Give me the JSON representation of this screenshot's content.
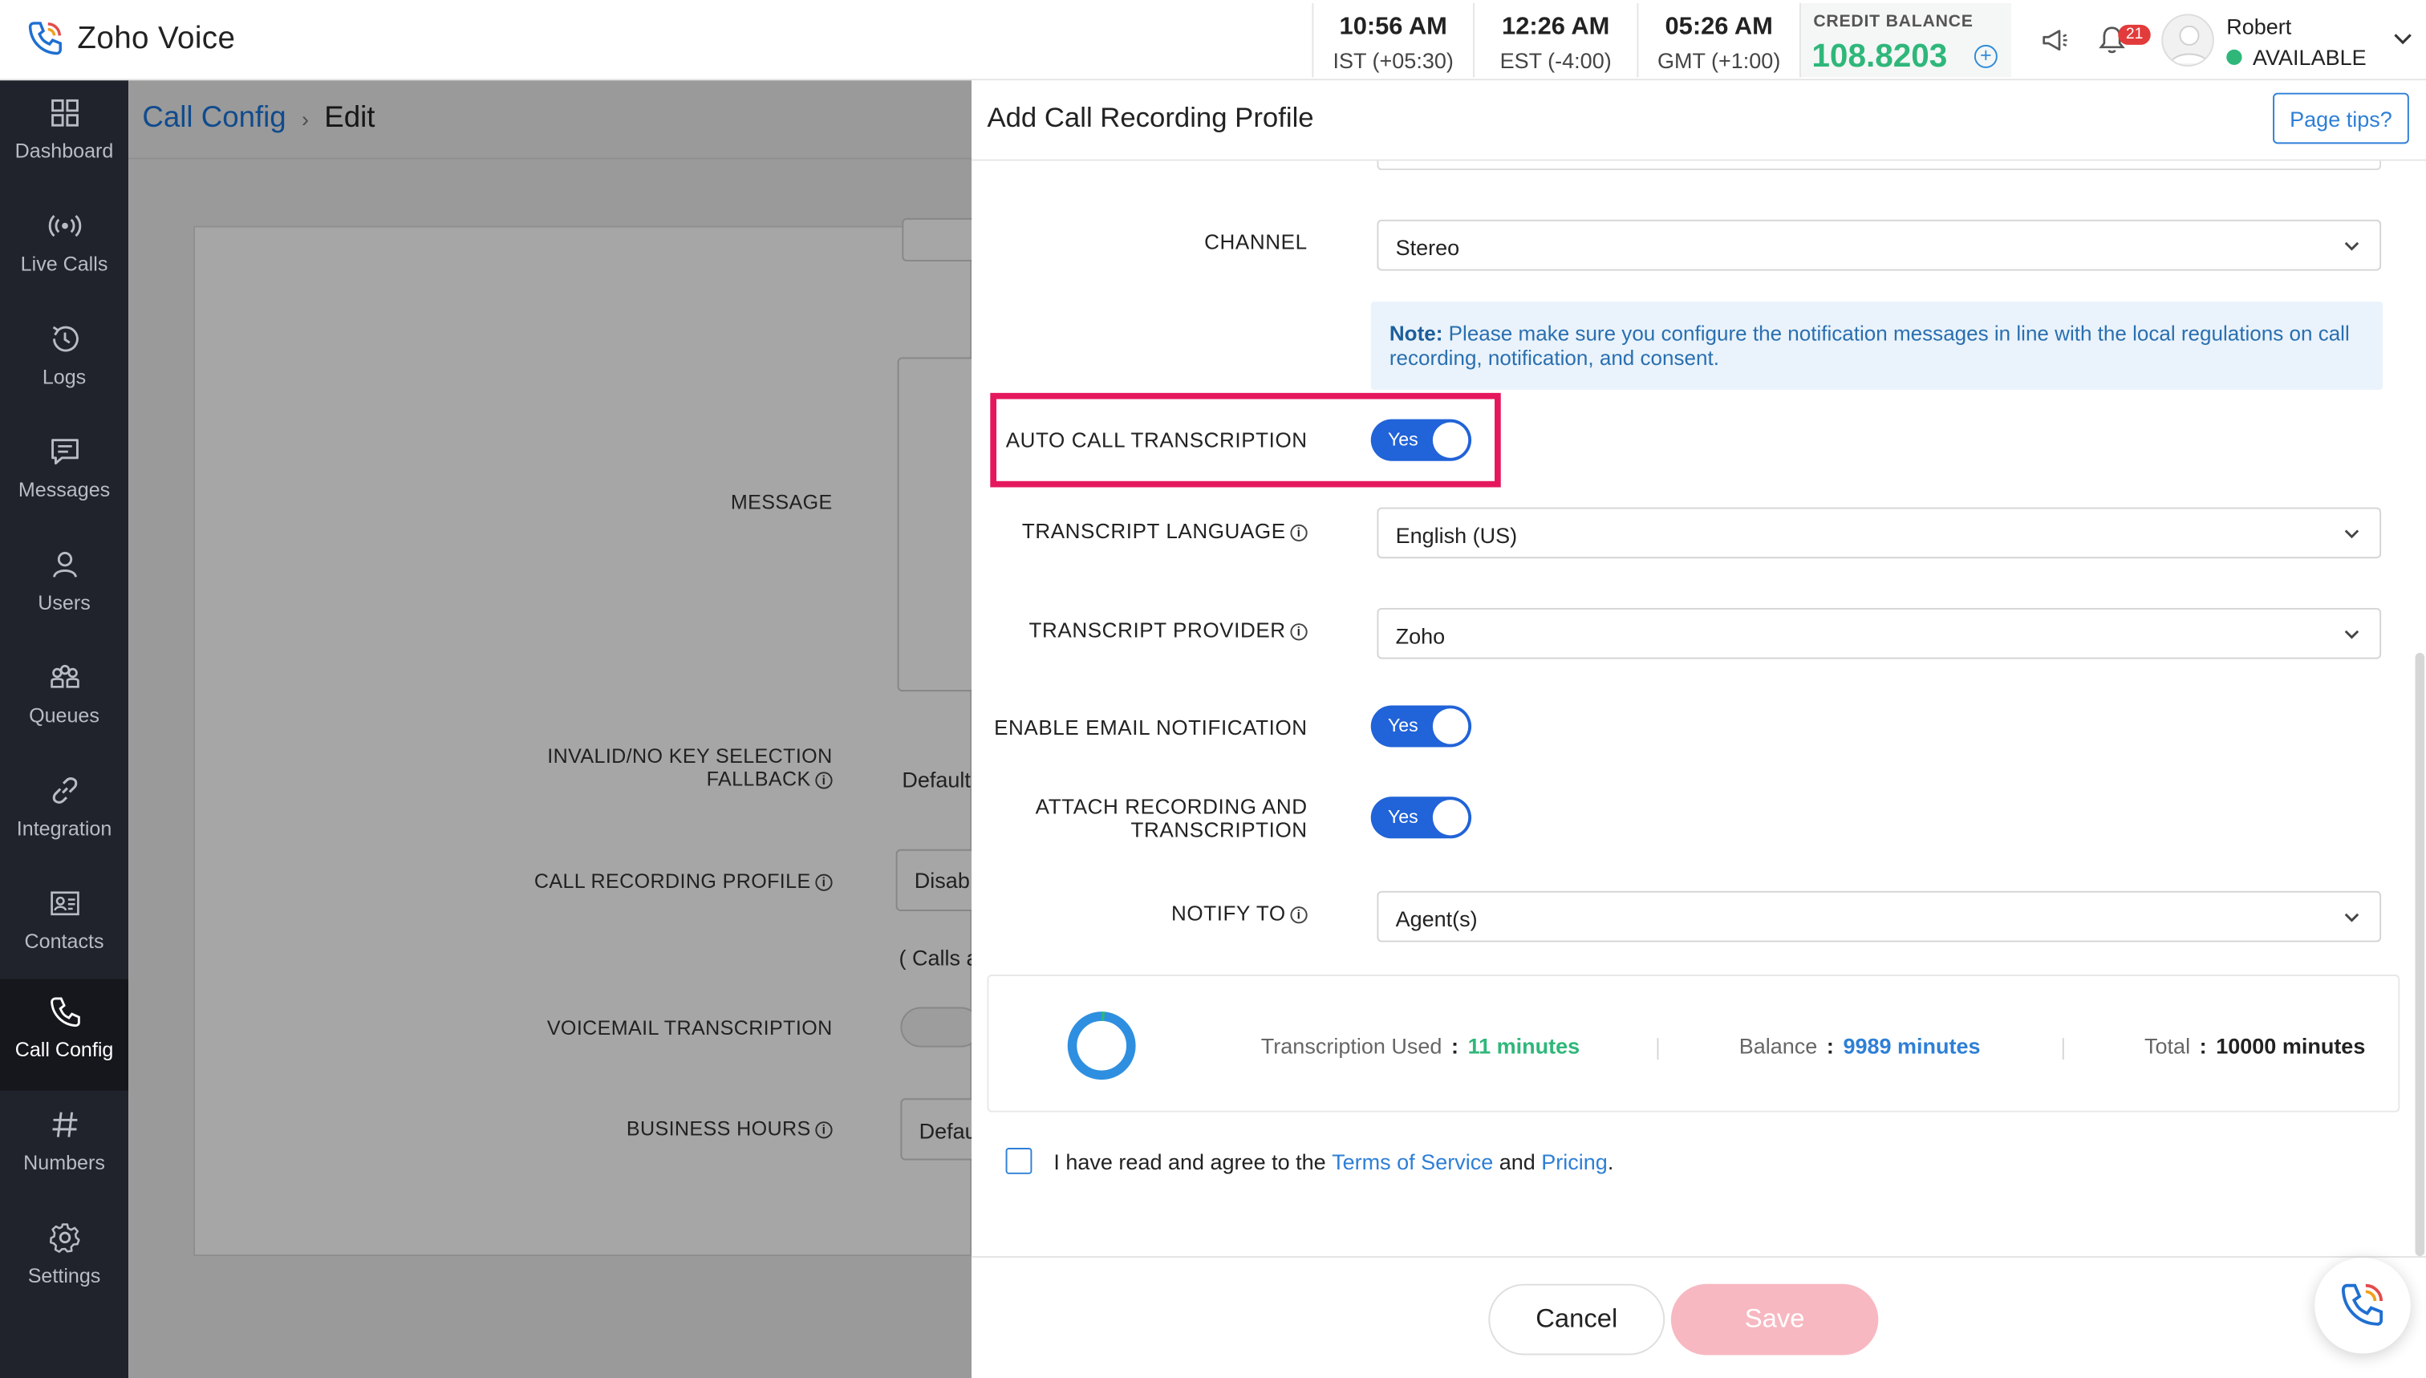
{
  "app": {
    "title": "Zoho Voice"
  },
  "header": {
    "clocks": [
      {
        "time": "10:56 AM",
        "zone": "IST (+05:30)"
      },
      {
        "time": "12:26 AM",
        "zone": "EST (-4:00)"
      },
      {
        "time": "05:26 AM",
        "zone": "GMT (+1:00)"
      }
    ],
    "credit": {
      "label": "CREDIT BALANCE",
      "value": "108.8203"
    },
    "notification_count": "21",
    "user": {
      "name": "Robert",
      "status": "AVAILABLE"
    }
  },
  "sidebar": {
    "items": [
      {
        "label": "Dashboard",
        "icon": "dashboard-icon"
      },
      {
        "label": "Live Calls",
        "icon": "live-calls-icon"
      },
      {
        "label": "Logs",
        "icon": "logs-icon"
      },
      {
        "label": "Messages",
        "icon": "messages-icon"
      },
      {
        "label": "Users",
        "icon": "users-icon"
      },
      {
        "label": "Queues",
        "icon": "queues-icon"
      },
      {
        "label": "Integration",
        "icon": "integration-icon"
      },
      {
        "label": "Contacts",
        "icon": "contacts-icon"
      },
      {
        "label": "Call Config",
        "icon": "call-config-icon",
        "active": true
      },
      {
        "label": "Numbers",
        "icon": "numbers-icon"
      },
      {
        "label": "Settings",
        "icon": "settings-icon"
      }
    ]
  },
  "background_page": {
    "breadcrumb": {
      "parent": "Call Config",
      "current": "Edit"
    },
    "fields": {
      "message": "MESSAGE",
      "fallback_line1": "INVALID/NO KEY SELECTION",
      "fallback_line2": "FALLBACK",
      "fallback_value": "Default",
      "call_recording_profile": "CALL RECORDING PROFILE",
      "call_recording_value": "Disab",
      "calls_note": "( Calls a",
      "voicemail_transcription": "VOICEMAIL TRANSCRIPTION",
      "business_hours": "BUSINESS HOURS",
      "business_hours_value": "Defau"
    }
  },
  "drawer": {
    "title": "Add Call Recording Profile",
    "page_tips": "Page tips?",
    "channel": {
      "label": "CHANNEL",
      "value": "Stereo"
    },
    "note": {
      "prefix": "Note:",
      "text": "Please make sure you configure the notification messages in line with the local regulations on call recording, notification, and consent."
    },
    "auto_call_transcription": {
      "label": "AUTO CALL TRANSCRIPTION",
      "toggle": "Yes"
    },
    "transcript_language": {
      "label": "TRANSCRIPT LANGUAGE",
      "value": "English (US)"
    },
    "transcript_provider": {
      "label": "TRANSCRIPT PROVIDER",
      "value": "Zoho"
    },
    "email_notification": {
      "label": "ENABLE EMAIL NOTIFICATION",
      "toggle": "Yes"
    },
    "attach_recording": {
      "label_line1": "ATTACH RECORDING AND",
      "label_line2": "TRANSCRIPTION",
      "toggle": "Yes"
    },
    "notify_to": {
      "label": "NOTIFY TO",
      "value": "Agent(s)"
    },
    "usage": {
      "used_label": "Transcription Used",
      "used_value": "11 minutes",
      "balance_label": "Balance",
      "balance_value": "9989 minutes",
      "total_label": "Total",
      "total_value": "10000 minutes",
      "used_fraction": 0.0011
    },
    "agree": {
      "text1": "I have read and agree to the",
      "terms": "Terms of Service",
      "and": "and",
      "pricing": "Pricing",
      "end": "."
    },
    "buttons": {
      "cancel": "Cancel",
      "save": "Save"
    }
  },
  "colors": {
    "sidebar_bg": "#20232b",
    "accent_blue": "#2163d8",
    "credit_green": "#2fb77a",
    "highlight_pink": "#e5185d",
    "save_disabled": "#f7b8c1"
  }
}
